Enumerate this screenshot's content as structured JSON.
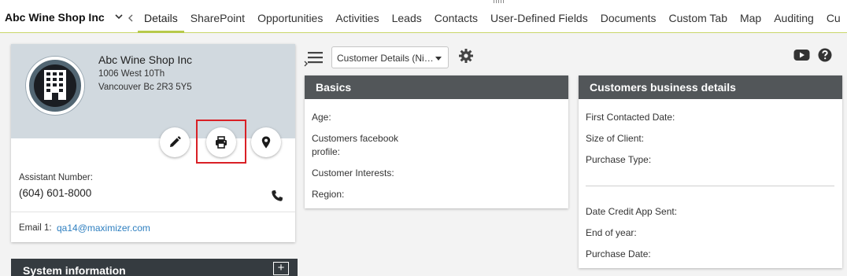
{
  "header": {
    "company_name": "Abc Wine Shop Inc",
    "tabs": [
      {
        "label": "Details",
        "active": true
      },
      {
        "label": "SharePoint"
      },
      {
        "label": "Opportunities"
      },
      {
        "label": "Activities"
      },
      {
        "label": "Leads"
      },
      {
        "label": "Contacts"
      },
      {
        "label": "User-Defined Fields"
      },
      {
        "label": "Documents"
      },
      {
        "label": "Custom Tab"
      },
      {
        "label": "Map"
      },
      {
        "label": "Auditing"
      },
      {
        "label": "Cu"
      }
    ]
  },
  "contact_card": {
    "name": "Abc Wine Shop Inc",
    "address_line1": "1006 West 10Th",
    "address_line2": "Vancouver Bc 2R3 5Y5",
    "assistant_label": "Assistant Number:",
    "assistant_phone": "(604) 601-8000",
    "email_label": "Email 1:",
    "email_value": "qa14@maximizer.com",
    "icons": [
      "edit-icon",
      "print-icon",
      "map-pin-icon",
      "phone-icon",
      "building-icon"
    ]
  },
  "system_info": {
    "title": "System information",
    "expand_label": "+"
  },
  "toolbar": {
    "view_select_value": "Customer Details (Ni…"
  },
  "basics_panel": {
    "title": "Basics",
    "fields": [
      "Age:",
      "Customers facebook",
      "profile:",
      "Customer Interests:",
      "Region:"
    ]
  },
  "business_panel": {
    "title": "Customers business details",
    "fields": [
      "First Contacted Date:",
      "Size of Client:",
      "Purchase Type:",
      "Date Credit App Sent:",
      "End of year:",
      "Purchase Date:"
    ]
  },
  "colors": {
    "accent_green": "#b7c94a",
    "panel_header": "#525659",
    "card_header": "#d1d9df",
    "highlight_red": "#d92026",
    "link_blue": "#2e7fc0"
  }
}
